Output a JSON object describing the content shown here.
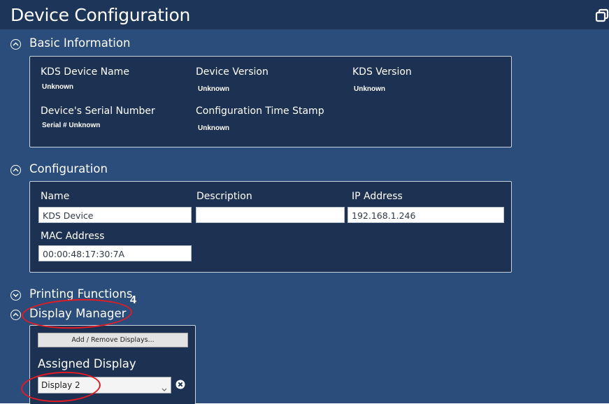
{
  "window": {
    "title": "Device Configuration"
  },
  "basic_info": {
    "header": "Basic Information",
    "device_name": {
      "label": "KDS Device Name",
      "value": "Unknown"
    },
    "device_version": {
      "label": "Device Version",
      "value": "Unknown"
    },
    "kds_version": {
      "label": "KDS Version",
      "value": "Unknown"
    },
    "serial_number": {
      "label": "Device's Serial Number",
      "value": "Serial # Unknown"
    },
    "config_timestamp": {
      "label": "Configuration Time Stamp",
      "value": "Unknown"
    }
  },
  "configuration": {
    "header": "Configuration",
    "name": {
      "label": "Name",
      "value": "KDS Device"
    },
    "description": {
      "label": "Description",
      "value": ""
    },
    "ip_address": {
      "label": "IP Address",
      "value": "192.168.1.246"
    },
    "mac_address": {
      "label": "MAC Address",
      "value": "00:00:48:17:30:7A"
    }
  },
  "printing_functions": {
    "header": "Printing Functions"
  },
  "display_manager": {
    "header": "Display Manager",
    "add_remove_button": "Add / Remove Displays...",
    "assigned_label": "Assigned Display",
    "selected_display": "Display 2"
  },
  "annotation": {
    "number": "4",
    "color": "#e21b24"
  },
  "icons": {
    "window": "restore-window-icon",
    "expanded": "chevron-up-circle-icon",
    "collapsed": "chevron-down-circle-icon",
    "clear": "clear-x-circle-icon",
    "dropdown": "chevron-down-icon"
  },
  "colors": {
    "titlebar": "#1d3558",
    "background": "#2a4d7c",
    "panel": "#1d3252"
  }
}
